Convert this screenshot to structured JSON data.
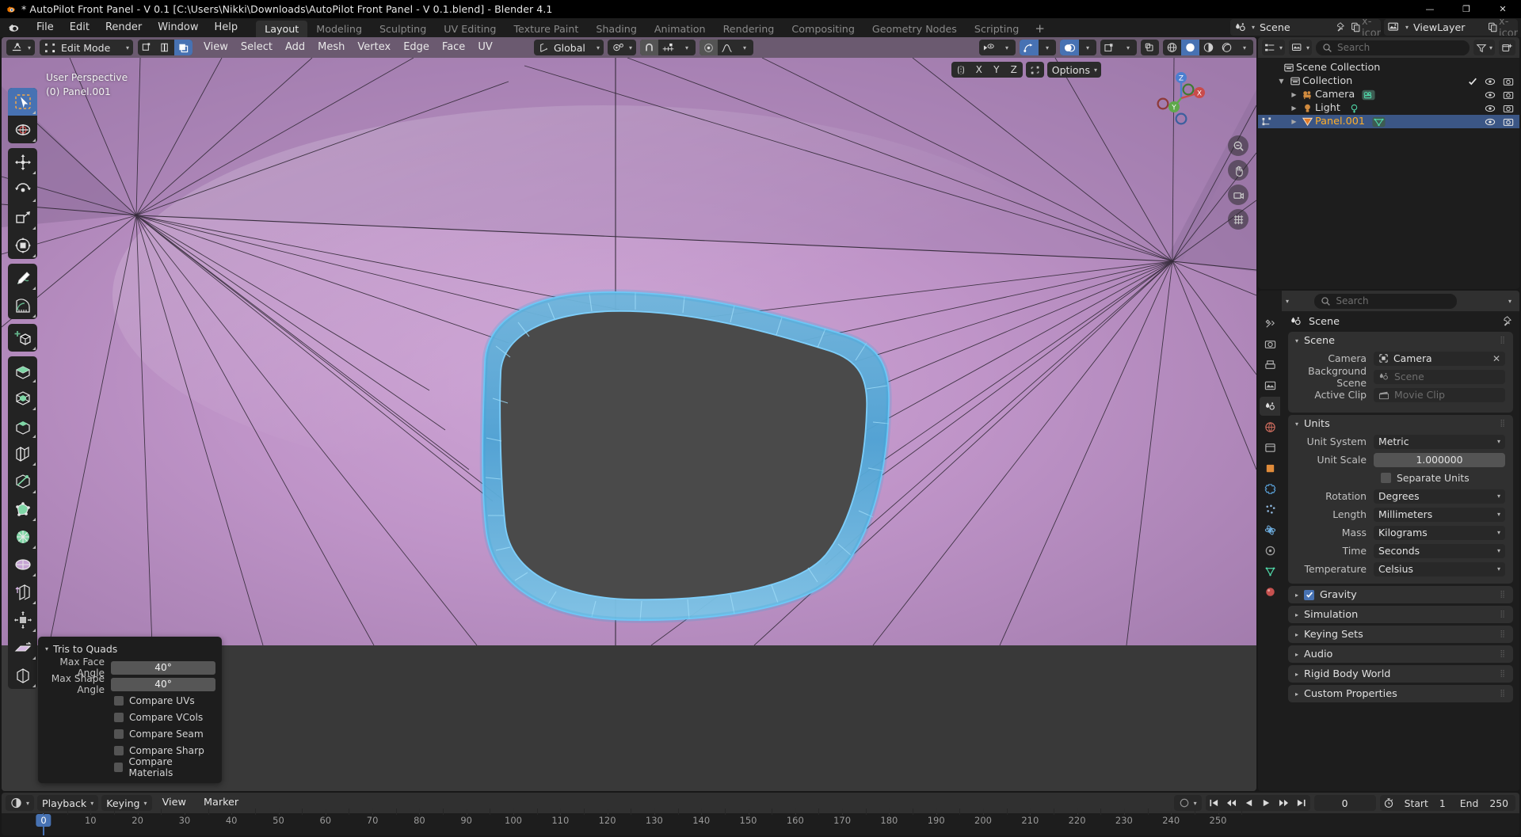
{
  "window": {
    "title": "* AutoPilot Front Panel - V 0.1 [C:\\Users\\Nikki\\Downloads\\AutoPilot Front Panel - V 0.1.blend] - Blender 4.1",
    "minimize": "—",
    "maximize": "❐",
    "close": "✕"
  },
  "topbar": {
    "menus": [
      "File",
      "Edit",
      "Render",
      "Window",
      "Help"
    ],
    "workspaces": [
      {
        "label": "Layout",
        "active": true
      },
      {
        "label": "Modeling",
        "active": false
      },
      {
        "label": "Sculpting",
        "active": false
      },
      {
        "label": "UV Editing",
        "active": false
      },
      {
        "label": "Texture Paint",
        "active": false
      },
      {
        "label": "Shading",
        "active": false
      },
      {
        "label": "Animation",
        "active": false
      },
      {
        "label": "Rendering",
        "active": false
      },
      {
        "label": "Compositing",
        "active": false
      },
      {
        "label": "Geometry Nodes",
        "active": false
      },
      {
        "label": "Scripting",
        "active": false
      }
    ],
    "add_workspace": "+",
    "scene": {
      "name": "Scene",
      "icon": "scene-icon",
      "new_icon": "duplicate-icon",
      "unlink_icon": "x-icon"
    },
    "viewlayer": {
      "name": "ViewLayer",
      "icon": "viewlayer-icon",
      "new_icon": "duplicate-icon",
      "unlink_icon": "x-icon"
    }
  },
  "viewport": {
    "mode": "Edit Mode",
    "menus": [
      "View",
      "Select",
      "Add",
      "Mesh",
      "Vertex",
      "Edge",
      "Face",
      "UV"
    ],
    "transform_orientation": "Global",
    "overlay_text_line1": "User Perspective",
    "overlay_text_line2": "(0) Panel.001",
    "proportional_axis": [
      "X",
      "Y",
      "Z"
    ],
    "options_label": "Options",
    "gizmo_axes": {
      "x": "X",
      "y": "Y",
      "z": "Z"
    },
    "colors": {
      "header_bg": "#6b5a70",
      "mesh_surface": "#b78cc0",
      "selection": "#4ab1e8",
      "hole_fill": "#4a4a4a",
      "accent": "#4772b3"
    }
  },
  "operator_panel": {
    "title": "Tris to Quads",
    "fields": [
      {
        "label": "Max Face Angle",
        "value": "40°"
      },
      {
        "label": "Max Shape Angle",
        "value": "40°"
      }
    ],
    "checkboxes": [
      {
        "label": "Compare UVs",
        "checked": false
      },
      {
        "label": "Compare VCols",
        "checked": false
      },
      {
        "label": "Compare Seam",
        "checked": false
      },
      {
        "label": "Compare Sharp",
        "checked": false
      },
      {
        "label": "Compare Materials",
        "checked": false
      }
    ]
  },
  "outliner": {
    "search_placeholder": "Search",
    "rows": [
      {
        "label": "Scene Collection",
        "indent": 0,
        "icon": "collection-icon",
        "arrow": false,
        "selected": false,
        "checkbox": false,
        "eye": false,
        "camera": false,
        "datatag": ""
      },
      {
        "label": "Collection",
        "indent": 1,
        "icon": "collection-icon",
        "arrow": true,
        "expanded": true,
        "selected": false,
        "checkbox": true,
        "eye": true,
        "camera": true,
        "datatag": ""
      },
      {
        "label": "Camera",
        "indent": 2,
        "icon": "camera-object-icon",
        "arrow": true,
        "expanded": false,
        "selected": false,
        "checkbox": false,
        "eye": true,
        "camera": true,
        "datatag": "camera-data-icon"
      },
      {
        "label": "Light",
        "indent": 2,
        "icon": "light-object-icon",
        "arrow": true,
        "expanded": false,
        "selected": false,
        "checkbox": false,
        "eye": true,
        "camera": true,
        "datatag": "light-data-icon"
      },
      {
        "label": "Panel.001",
        "indent": 2,
        "icon": "mesh-object-icon",
        "arrow": true,
        "expanded": false,
        "selected": true,
        "checkbox": false,
        "eye": true,
        "camera": true,
        "datatag": "mesh-data-icon"
      }
    ]
  },
  "properties": {
    "search_placeholder": "Search",
    "breadcrumb": "Scene",
    "panels": [
      {
        "title": "Scene",
        "open": true,
        "rows": [
          {
            "label": "Camera",
            "value": "Camera",
            "type": "id",
            "icon": "camera-icon",
            "clear": true
          },
          {
            "label": "Background Scene",
            "value": "Scene",
            "type": "id-empty",
            "icon": "scene-icon",
            "clear": false
          },
          {
            "label": "Active Clip",
            "value": "Movie Clip",
            "type": "id-empty",
            "icon": "clip-icon",
            "clear": false
          }
        ]
      },
      {
        "title": "Units",
        "open": true,
        "rows": [
          {
            "label": "Unit System",
            "value": "Metric",
            "type": "dropdown"
          },
          {
            "label": "Unit Scale",
            "value": "1.000000",
            "type": "value"
          },
          {
            "label": "Separate Units",
            "value": "",
            "type": "checkbox",
            "checked": false
          },
          {
            "label": "Rotation",
            "value": "Degrees",
            "type": "dropdown"
          },
          {
            "label": "Length",
            "value": "Millimeters",
            "type": "dropdown"
          },
          {
            "label": "Mass",
            "value": "Kilograms",
            "type": "dropdown"
          },
          {
            "label": "Time",
            "value": "Seconds",
            "type": "dropdown"
          },
          {
            "label": "Temperature",
            "value": "Celsius",
            "type": "dropdown"
          }
        ]
      }
    ],
    "closed_panels": [
      {
        "title": "Gravity",
        "checkbox": true,
        "checked": true
      },
      {
        "title": "Simulation",
        "checkbox": false
      },
      {
        "title": "Keying Sets",
        "checkbox": false
      },
      {
        "title": "Audio",
        "checkbox": false
      },
      {
        "title": "Rigid Body World",
        "checkbox": false
      },
      {
        "title": "Custom Properties",
        "checkbox": false
      }
    ]
  },
  "timeline": {
    "menus": [
      "View",
      "Marker"
    ],
    "dropdowns": [
      "Playback",
      "Keying"
    ],
    "current_frame": "0",
    "start_label": "Start",
    "start_value": "1",
    "end_label": "End",
    "end_value": "250",
    "ticks": [
      "0",
      "10",
      "20",
      "30",
      "40",
      "50",
      "60",
      "70",
      "80",
      "90",
      "100",
      "110",
      "120",
      "130",
      "140",
      "150",
      "160",
      "170",
      "180",
      "190",
      "200",
      "210",
      "220",
      "230",
      "240",
      "250"
    ],
    "playhead_frame": "0"
  }
}
